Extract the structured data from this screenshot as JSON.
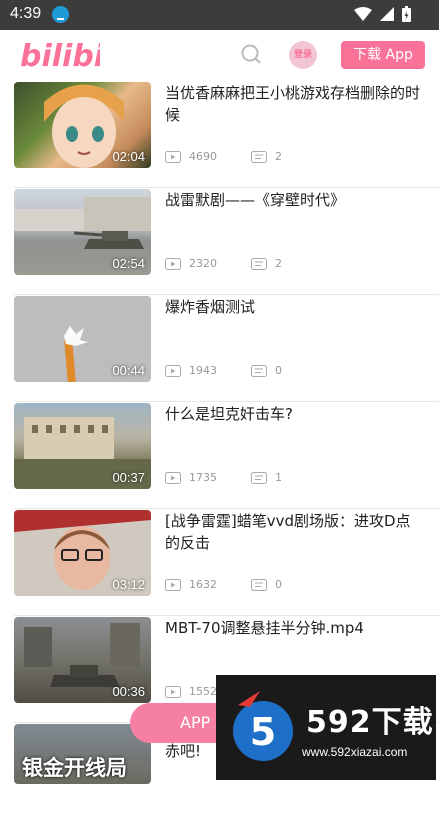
{
  "status": {
    "time": "4:39"
  },
  "header": {
    "logo": "bilibili",
    "login_label": "登录",
    "download_label": "下载 App"
  },
  "colors": {
    "brand": "#fb7299",
    "status_bar": "#3c3c3c"
  },
  "videos": [
    {
      "title": "当优香麻麻把王小桃游戏存档删除的时候",
      "duration": "02:04",
      "plays": "4690",
      "comments": "2"
    },
    {
      "title": "战雷默剧——《穿壁时代》",
      "duration": "02:54",
      "plays": "2320",
      "comments": "2"
    },
    {
      "title": "爆炸香烟测试",
      "duration": "00:44",
      "plays": "1943",
      "comments": "0"
    },
    {
      "title": "什么是坦克奸击车?",
      "duration": "00:37",
      "plays": "1735",
      "comments": "1"
    },
    {
      "title": "[战争雷霆]蜡笔vvd剧场版：进攻D点的反击",
      "duration": "03:12",
      "plays": "1632",
      "comments": "0"
    },
    {
      "title": "MBT-70调整悬挂半分钟.mp4",
      "duration": "00:36",
      "plays": "1552",
      "comments": ""
    },
    {
      "title": "赤吧!",
      "duration": "",
      "plays": "",
      "comments": "",
      "thumb_text": "银金开线局"
    }
  ],
  "floating": {
    "app_pill": "APP"
  },
  "watermark": {
    "brand": "592下载",
    "url": "www.592xiazai.com",
    "badge": "5"
  }
}
